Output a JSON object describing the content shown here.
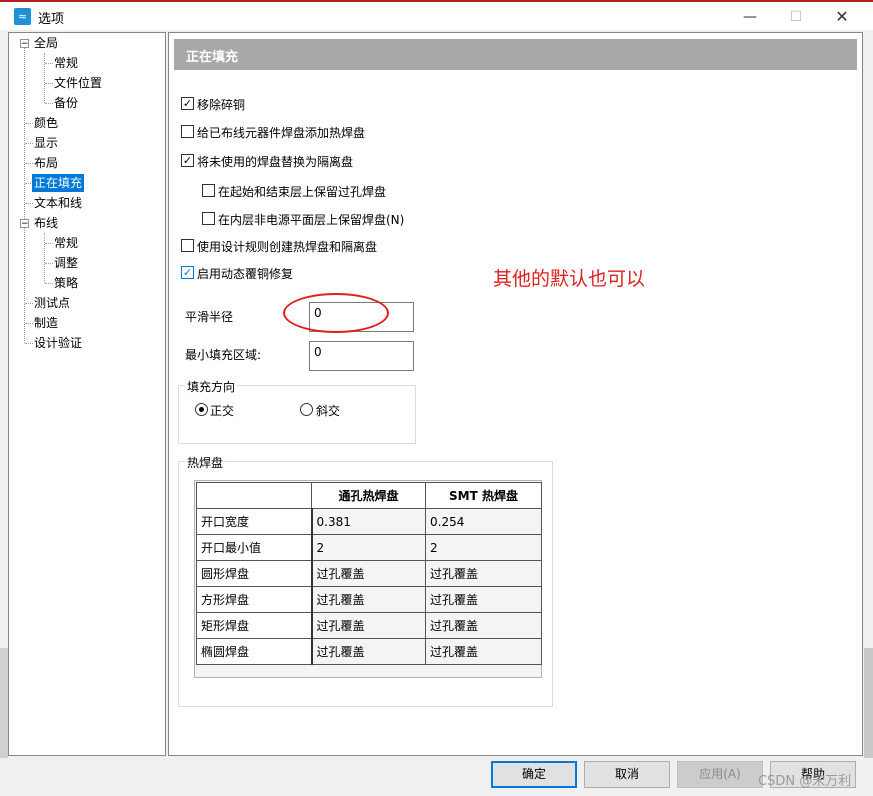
{
  "window": {
    "title": "选项"
  },
  "tree": {
    "items": [
      {
        "label": "全局"
      },
      {
        "label": "常规"
      },
      {
        "label": "文件位置"
      },
      {
        "label": "备份"
      },
      {
        "label": "颜色"
      },
      {
        "label": "显示"
      },
      {
        "label": "布局"
      },
      {
        "label": "正在填充",
        "selected": true
      },
      {
        "label": "文本和线"
      },
      {
        "label": "布线"
      },
      {
        "label": "常规"
      },
      {
        "label": "调整"
      },
      {
        "label": "策略"
      },
      {
        "label": "测试点"
      },
      {
        "label": "制造"
      },
      {
        "label": "设计验证"
      }
    ]
  },
  "panel": {
    "title": "正在填充",
    "checkboxes": [
      {
        "label": "移除碎铜",
        "checked": true
      },
      {
        "label": "给已布线元器件焊盘添加热焊盘",
        "checked": false
      },
      {
        "label": "将未使用的焊盘替换为隔离盘",
        "checked": true
      },
      {
        "label": "在起始和结束层上保留过孔焊盘",
        "checked": false
      },
      {
        "label": "在内层非电源平面层上保留焊盘(N)",
        "checked": false
      },
      {
        "label": "使用设计规则创建热焊盘和隔离盘",
        "checked": false
      },
      {
        "label": "启用动态覆铜修复",
        "checked": true
      }
    ],
    "smooth_radius": {
      "label": "平滑半径",
      "value": "0"
    },
    "min_fill_area": {
      "label": "最小填充区域:",
      "value": "0"
    },
    "fill_direction": {
      "title": "填充方向",
      "options": [
        {
          "label": "正交",
          "selected": true
        },
        {
          "label": "斜交",
          "selected": false
        }
      ]
    },
    "thermal": {
      "title": "热焊盘",
      "columns": [
        "",
        "通孔热焊盘",
        "SMT 热焊盘"
      ],
      "rows": [
        [
          "开口宽度",
          "0.381",
          "0.254"
        ],
        [
          "开口最小值",
          "2",
          "2"
        ],
        [
          "圆形焊盘",
          "过孔覆盖",
          "过孔覆盖"
        ],
        [
          "方形焊盘",
          "过孔覆盖",
          "过孔覆盖"
        ],
        [
          "矩形焊盘",
          "过孔覆盖",
          "过孔覆盖"
        ],
        [
          "椭圆焊盘",
          "过孔覆盖",
          "过孔覆盖"
        ]
      ]
    }
  },
  "annotation": {
    "text": "其他的默认也可以",
    "color": "#e02020"
  },
  "footer": {
    "ok": "确定",
    "cancel": "取消",
    "apply": "应用(A)",
    "help": "帮助"
  },
  "watermark": "CSDN @宋万利",
  "colors": {
    "accent": "#0078d7",
    "header": "#a9a9a9"
  }
}
